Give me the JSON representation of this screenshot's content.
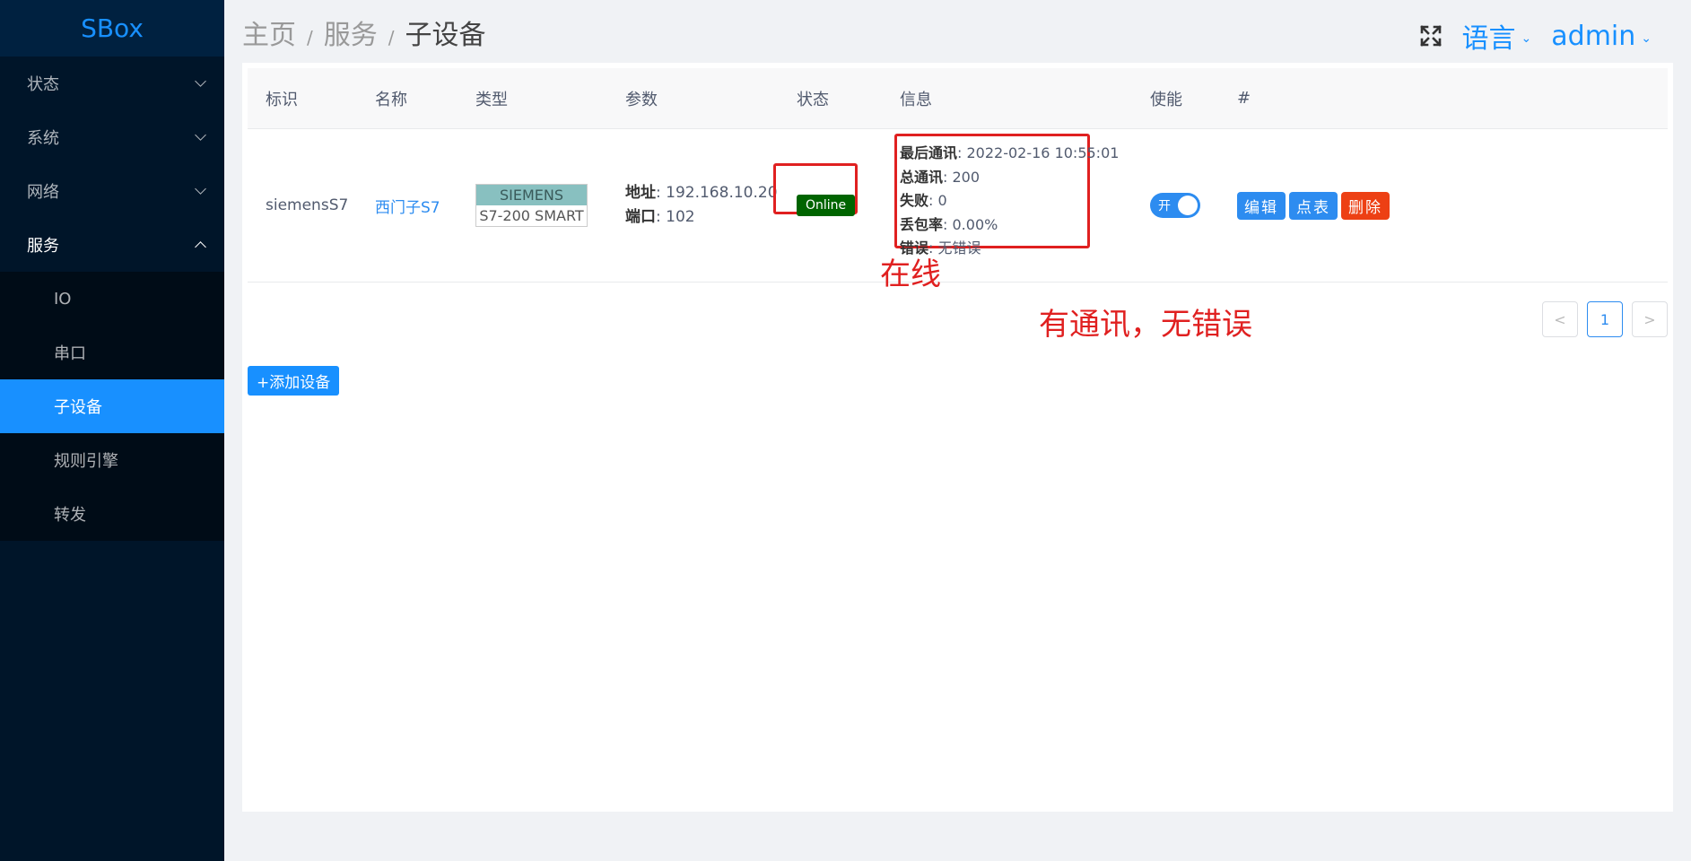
{
  "sidebar": {
    "logo": "SBox",
    "menus": [
      {
        "label": "状态"
      },
      {
        "label": "系统"
      },
      {
        "label": "网络"
      },
      {
        "label": "服务"
      }
    ],
    "submenu": [
      {
        "label": "IO"
      },
      {
        "label": "串口"
      },
      {
        "label": "子设备"
      },
      {
        "label": "规则引擎"
      },
      {
        "label": "转发"
      }
    ]
  },
  "header": {
    "breadcrumb": [
      "主页",
      "服务",
      "子设备"
    ],
    "separator": "/",
    "language": "语言",
    "user": "admin",
    "caret": "⌄"
  },
  "table": {
    "columns": [
      "标识",
      "名称",
      "类型",
      "参数",
      "状态",
      "信息",
      "使能",
      "#"
    ],
    "rows": [
      {
        "id": "siemensS7",
        "name": "西门子S7",
        "type_brand": "SIEMENS",
        "type_model": "S7-200 SMART",
        "param_addr_label": "地址",
        "param_addr": "192.168.10.20",
        "param_port_label": "端口",
        "param_port": "102",
        "status": "Online",
        "info": [
          {
            "label": "最后通讯",
            "value": "2022-02-16 10:55:01"
          },
          {
            "label": "总通讯",
            "value": "200"
          },
          {
            "label": "失败",
            "value": "0"
          },
          {
            "label": "丢包率",
            "value": "0.00%"
          },
          {
            "label": "错误",
            "value": "无错误"
          }
        ],
        "enabled_label": "开",
        "enabled": true,
        "actions": [
          "编辑",
          "点表",
          "删除"
        ]
      }
    ]
  },
  "annotations": {
    "status_note": "在线",
    "info_note": "有通讯，无错误"
  },
  "pagination": {
    "prev": "<",
    "page": "1",
    "next": ">"
  },
  "add_button": "+添加设备",
  "colors": {
    "accent": "#1890ff",
    "online": "#006400",
    "annotation": "#e02020",
    "danger": "#ed4014"
  }
}
